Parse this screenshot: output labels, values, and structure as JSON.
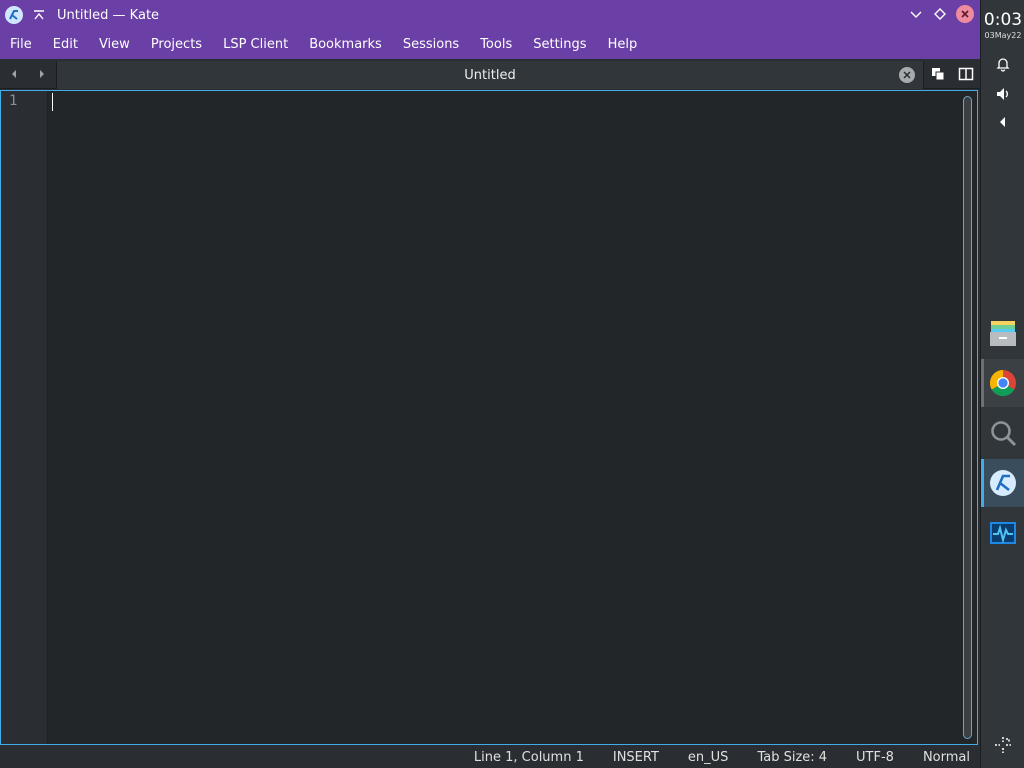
{
  "window": {
    "title": "Untitled — Kate",
    "app_icon": "kate-icon",
    "controls": [
      "minimize-chevron-icon",
      "maximize-diamond-icon",
      "close-icon"
    ]
  },
  "menubar": {
    "items": [
      "File",
      "Edit",
      "View",
      "Projects",
      "LSP Client",
      "Bookmarks",
      "Sessions",
      "Tools",
      "Settings",
      "Help"
    ]
  },
  "tabbar": {
    "tab_label": "Untitled"
  },
  "editor": {
    "line_numbers": [
      "1"
    ]
  },
  "statusbar": {
    "position": "Line 1, Column 1",
    "mode": "INSERT",
    "dictionary": "en_US",
    "tab_size": "Tab Size: 4",
    "encoding": "UTF-8",
    "highlighting": "Normal"
  },
  "panel": {
    "time": "0:03",
    "date": "03May22",
    "tray_icons": [
      "bell-icon",
      "speaker-icon",
      "expand-arrow-icon"
    ],
    "tasks": [
      "file-manager-icon",
      "chrome-icon",
      "search-icon",
      "kate-icon",
      "system-monitor-icon"
    ],
    "active_task": "kate-icon"
  },
  "colors": {
    "titlebar": "#6a3fa6",
    "accent": "#3daee9",
    "editor_bg": "#232629",
    "close_button": "#ee8b9e"
  }
}
